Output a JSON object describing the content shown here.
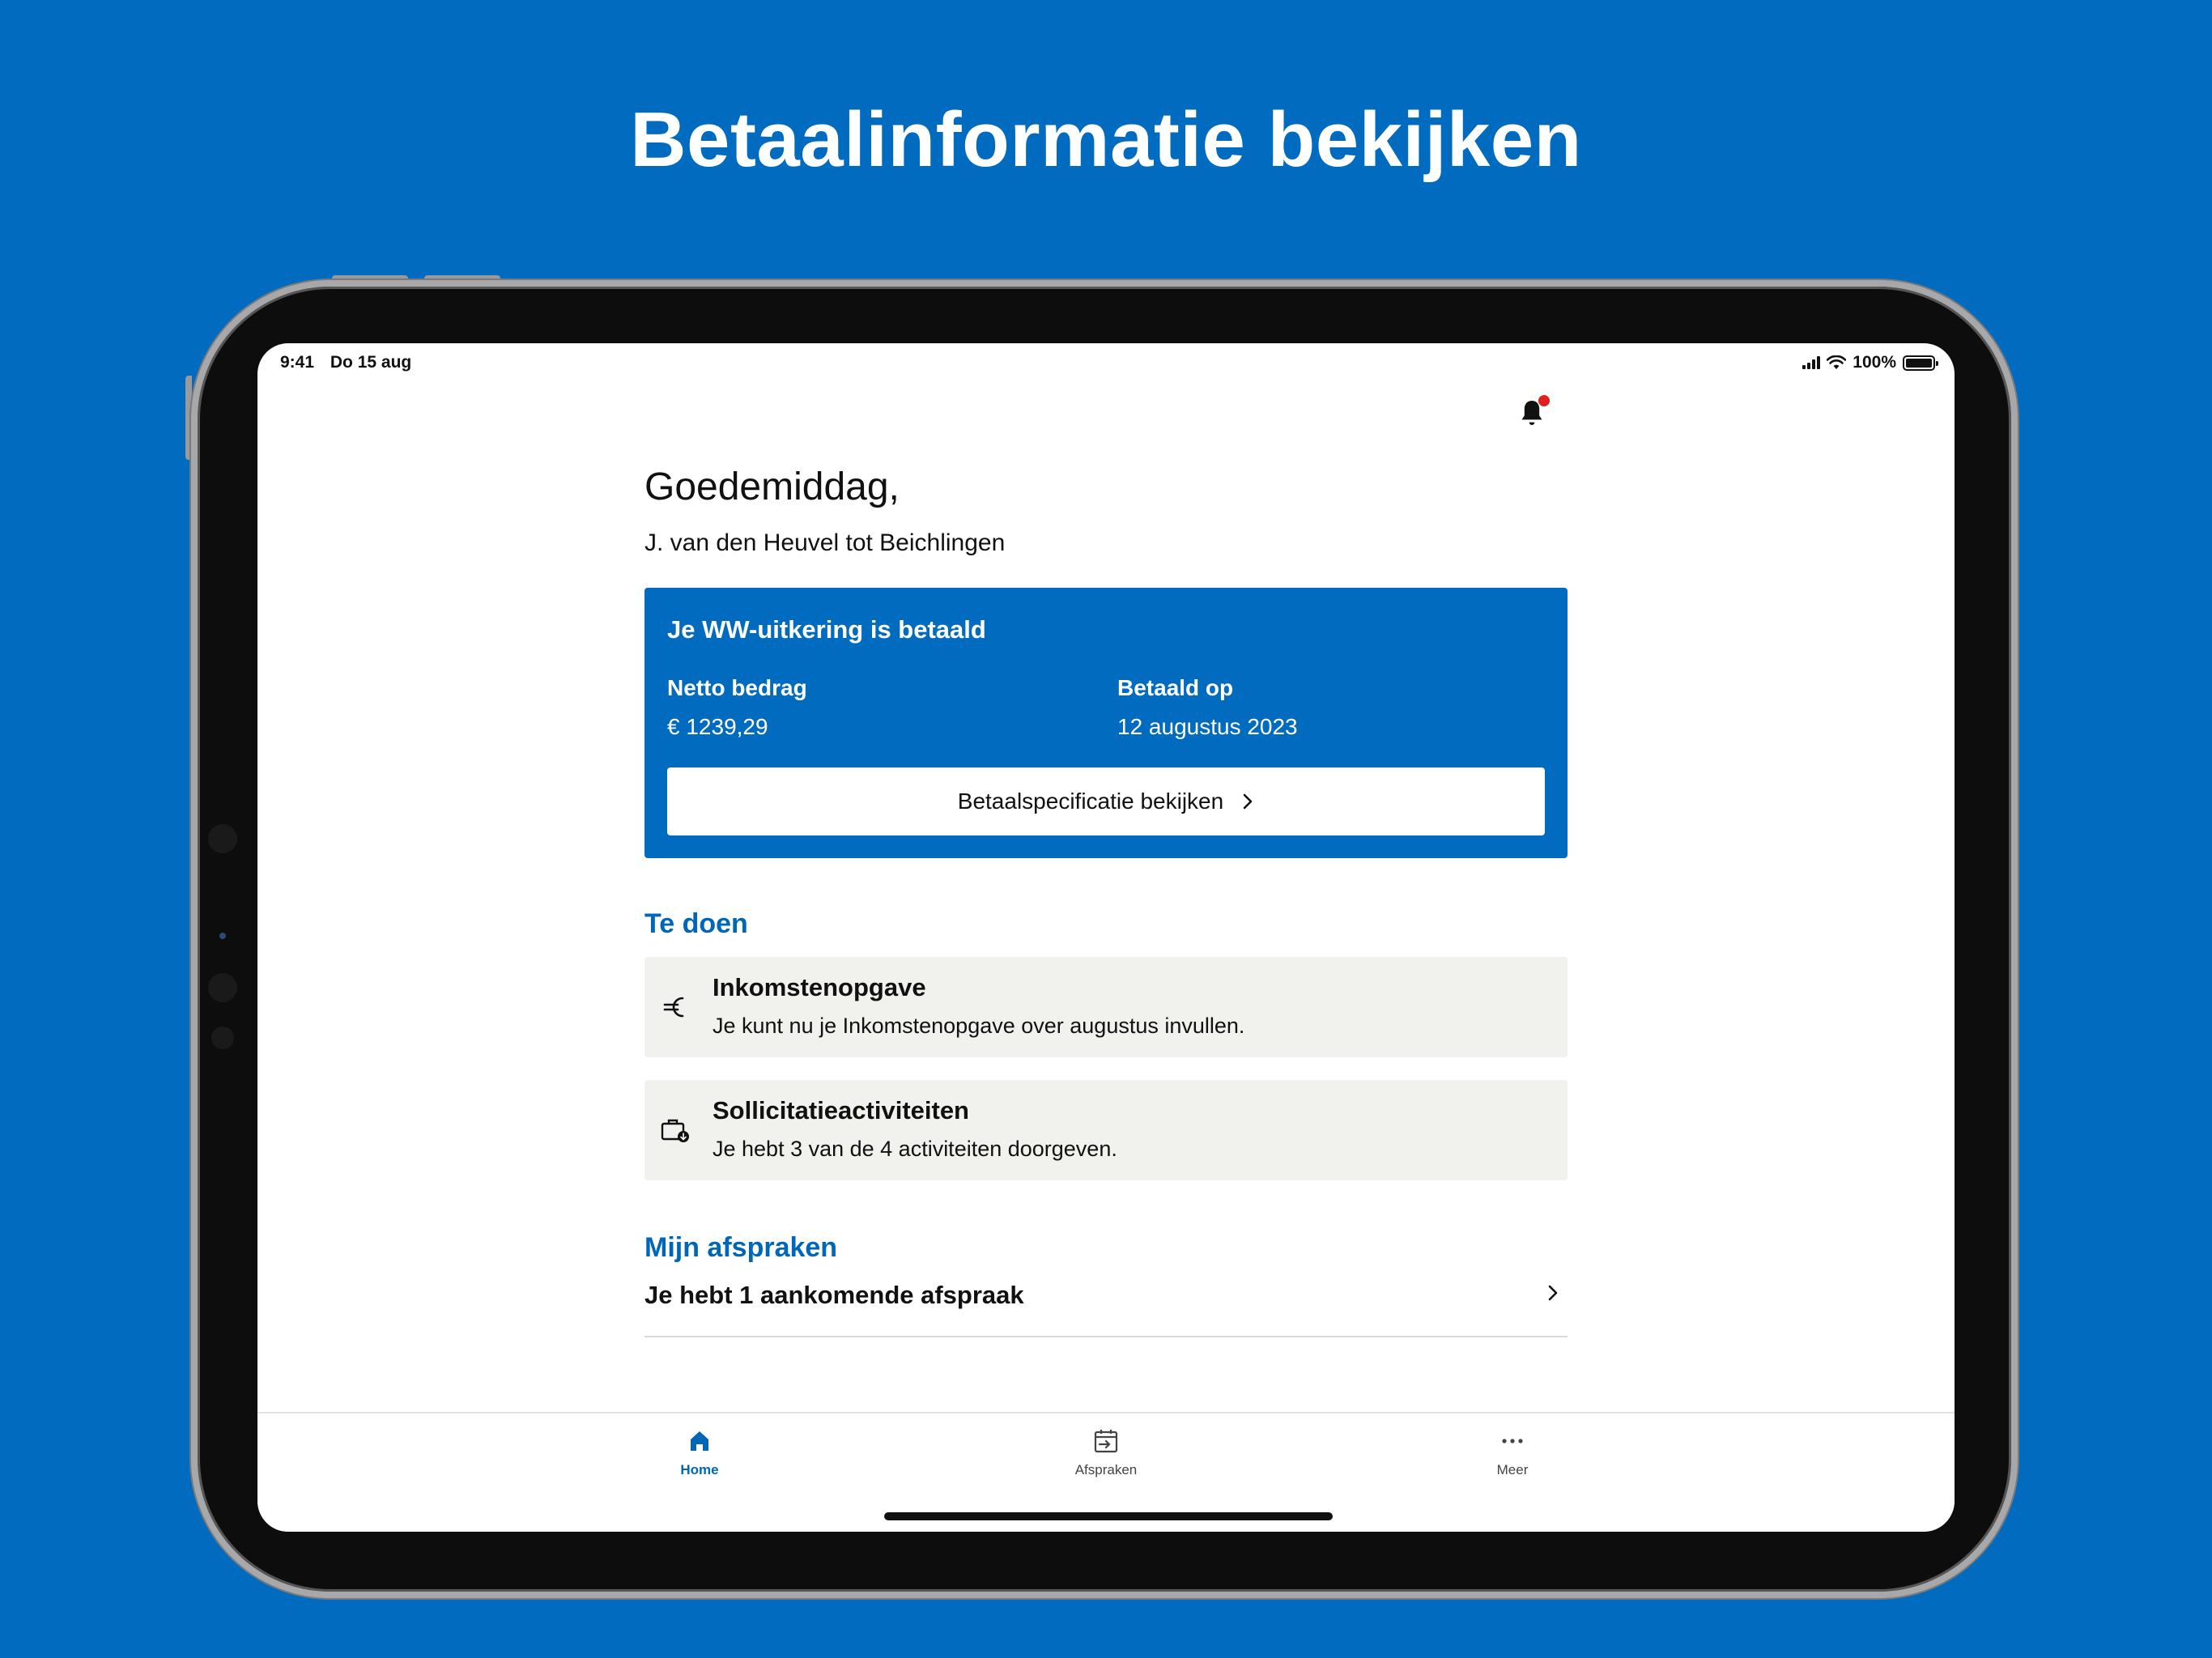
{
  "headline": "Betaalinformatie bekijken",
  "status": {
    "time": "9:41",
    "date": "Do 15 aug",
    "battery": "100%"
  },
  "greeting": "Goedemiddag,",
  "user_name": "J. van den Heuvel tot Beichlingen",
  "payment": {
    "title": "Je WW-uitkering is betaald",
    "net_label": "Netto bedrag",
    "net_value": "€ 1239,29",
    "date_label": "Betaald op",
    "date_value": "12 augustus 2023",
    "button_label": "Betaalspecificatie bekijken"
  },
  "todo": {
    "heading": "Te doen",
    "items": [
      {
        "title": "Inkomstenopgave",
        "subtitle": "Je kunt nu je Inkomstenopgave over augustus invullen.",
        "icon": "euro-icon"
      },
      {
        "title": "Sollicitatieactiviteiten",
        "subtitle": "Je hebt 3 van de 4 activiteiten doorgeven.",
        "icon": "briefcase-icon"
      }
    ]
  },
  "appointments": {
    "heading": "Mijn afspraken",
    "summary": "Je hebt 1 aankomende afspraak"
  },
  "tabs": [
    {
      "label": "Home",
      "icon": "home-icon",
      "active": true
    },
    {
      "label": "Afspraken",
      "icon": "calendar-icon",
      "active": false
    },
    {
      "label": "Meer",
      "icon": "more-icon",
      "active": false
    }
  ],
  "colors": {
    "brand": "#006bbf",
    "accent_text": "#0067b8",
    "notification_dot": "#e02020",
    "card_grey": "#f1f1ee"
  }
}
